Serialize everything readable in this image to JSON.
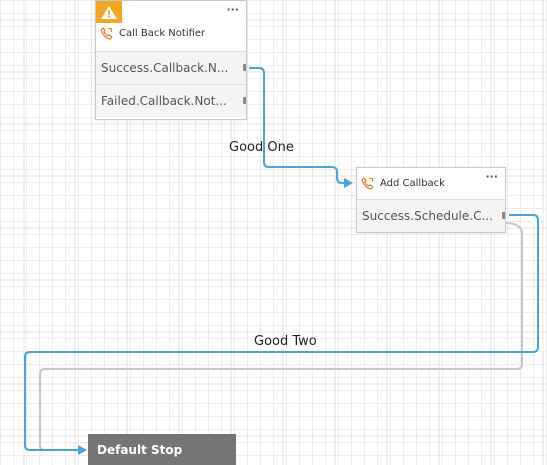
{
  "nodes": {
    "callback_notifier": {
      "title": "Call Back Notifier",
      "icon": "phone-callback-icon",
      "has_warning": true,
      "more": "···",
      "outcomes": [
        "Success.Callback.N...",
        "Failed.Callback.Not..."
      ]
    },
    "add_callback": {
      "title": "Add Callback",
      "icon": "phone-callback-icon",
      "more": "···",
      "outcomes": [
        "Success.Schedule.C..."
      ]
    },
    "default_stop": {
      "title": "Default Stop"
    }
  },
  "edges": {
    "good_one": "Good One",
    "good_two": "Good Two"
  },
  "colors": {
    "connector_active": "#4aa3df",
    "connector_inactive": "#c7c7c7",
    "warning": "#f5a623",
    "phone_icon": "#e8772e",
    "stop_bg": "#757575"
  }
}
